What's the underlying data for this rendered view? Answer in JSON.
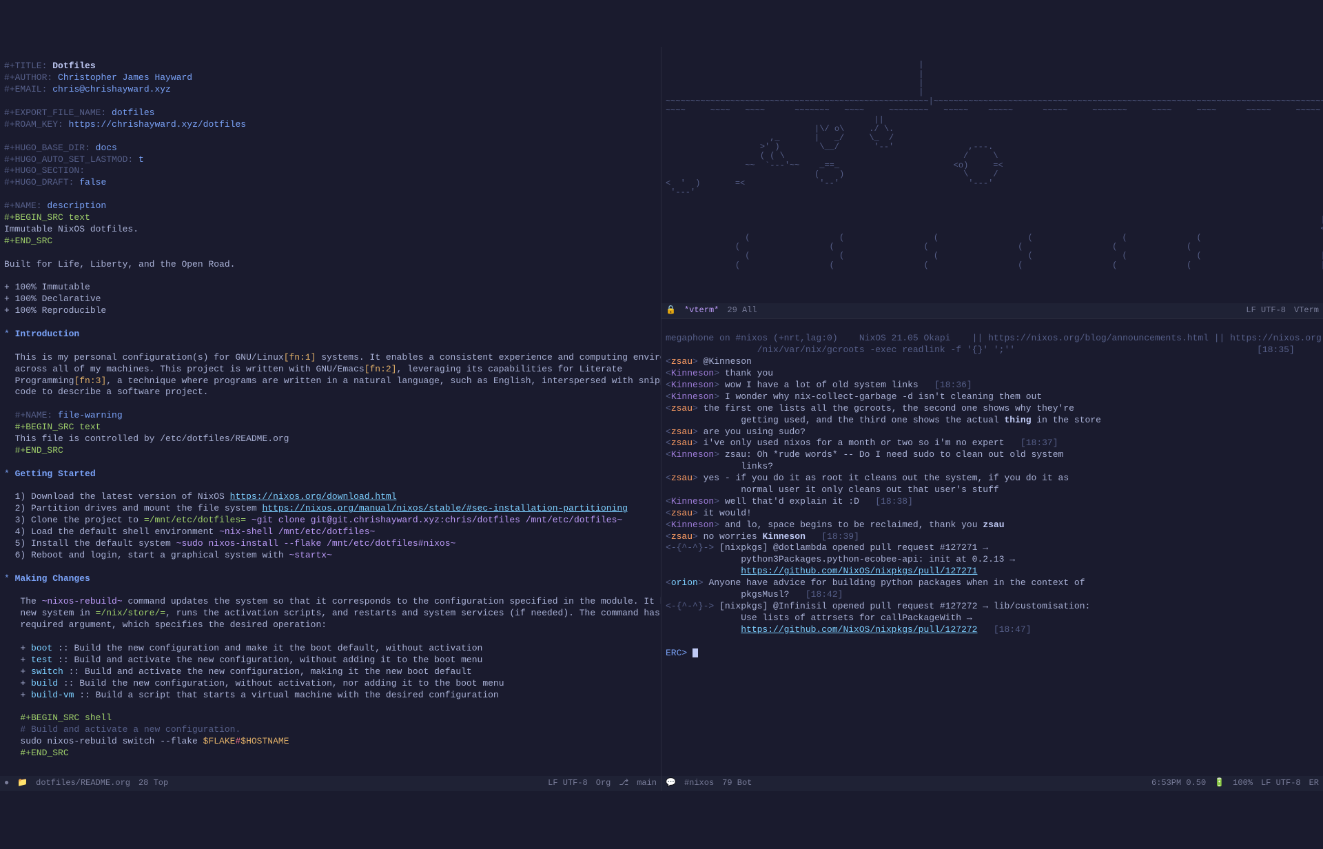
{
  "org": {
    "k_title": "#+TITLE:",
    "title": "Dotfiles",
    "k_author": "#+AUTHOR:",
    "author": "Christopher James Hayward",
    "k_email": "#+EMAIL:",
    "email": "chris@chrishayward.xyz",
    "k_export": "#+EXPORT_FILE_NAME:",
    "export": "dotfiles",
    "k_roam": "#+ROAM_KEY:",
    "roam": "https://chrishayward.xyz/dotfiles",
    "k_hugodir": "#+HUGO_BASE_DIR:",
    "hugodir": "docs",
    "k_hugolast": "#+HUGO_AUTO_SET_LASTMOD:",
    "hugolast": "t",
    "k_hugosec": "#+HUGO_SECTION:",
    "k_hugodraft": "#+HUGO_DRAFT:",
    "hugodraft": "false",
    "k_name1": "#+NAME:",
    "name1": "description",
    "k_begin_text": "#+BEGIN_SRC text",
    "desc_body": "Immutable NixOS dotfiles.",
    "k_end": "#+END_SRC",
    "tagline": "Built for Life, Liberty, and the Open Road.",
    "bullets": [
      "+ 100% Immutable",
      "+ 100% Declarative",
      "+ 100% Reproducible"
    ],
    "h_intro": "Introduction",
    "intro_1a": "This is my personal configuration(s) for GNU/Linux",
    "fn1": "[fn:1]",
    "intro_1b": " systems. It enables a consistent experience and computing environment",
    "intro_2a": "across all of my machines. This project is written with GNU/Emacs",
    "fn2": "[fn:2]",
    "intro_2b": ", leveraging its capabilities for Literate",
    "intro_3a": "Programming",
    "fn3": "[fn:3]",
    "intro_3b": ", a technique where programs are written in a natural language, such as English, interspersed with snippets of",
    "intro_4": "code to describe a software project.",
    "k_name2": "#+NAME:",
    "name2": "file-warning",
    "fw_body": "This file is controlled by /etc/dotfiles/README.org",
    "h_getting": "Getting Started",
    "gs1a": "1) Download the latest version of NixOS ",
    "gs1link": "https://nixos.org/download.html",
    "gs2a": "2) Partition drives and mount the file system ",
    "gs2link": "https://nixos.org/manual/nixos/stable/#sec-installation-partitioning",
    "gs3a": "3) Clone the project to ",
    "gs3c1": "=/mnt/etc/dotfiles=",
    "gs3c2": " ~git clone git@git.chrishayward.xyz:chris/dotfiles /mnt/etc/dotfiles~",
    "gs4a": "4) Load the default shell environment ",
    "gs4c": "~nix-shell /mnt/etc/dotfiles~",
    "gs5a": "5) Install the default system ",
    "gs5c": "~sudo nixos-install --flake /mnt/etc/dotfiles#nixos~",
    "gs6a": "6) Reboot and login, start a graphical system with ",
    "gs6c": "~startx~",
    "h_making": "Making Changes",
    "mc1a": "The ",
    "mc1c": "~nixos-rebuild~",
    "mc1b": " command updates the system so that it corresponds to the configuration specified in the module. It builds the",
    "mc2a": "new system in ",
    "mc2c": "=/nix/store/=",
    "mc2b": ", runs the activation scripts, and restarts and system services (if needed). The command has one",
    "mc3": "required argument, which specifies the desired operation:",
    "ops": [
      {
        "k": "boot",
        "v": " :: Build the new configuration and make it the boot default, without activation"
      },
      {
        "k": "test",
        "v": " :: Build and activate the new configuration, without adding it to the boot menu"
      },
      {
        "k": "switch",
        "v": " :: Build and activate the new configuration, making it the new boot default"
      },
      {
        "k": "build",
        "v": " :: Build the new configuration, without activation, nor adding it to the boot menu"
      },
      {
        "k": "build-vm",
        "v": " :: Build a script that starts a virtual machine with the desired configuration"
      }
    ],
    "k_begin_shell": "#+BEGIN_SRC shell",
    "sh_comment": "# Build and activate a new configuration.",
    "sh_l": "sudo nixos-rebuild switch --flake ",
    "sh_flake": "$FLAKE",
    "sh_hash": "#",
    "sh_host": "$HOSTNAME",
    "modeline": {
      "file": "dotfiles/README.org",
      "pos": "28 Top",
      "enc": "LF UTF-8",
      "major": "Org",
      "branch": "main"
    }
  },
  "vterm": {
    "ascii": "                                                   |\n                                                   |\n                                                   |\n                                                   |\n~~~~~~~~~~~~~~~~~~~~~~~~~~~~~~~~~~~~~~~~~~~~~~~~~~~~~|~~~~~~~~~~~~~~~~~~~~~~~~~~~~~~~~~~~~~~~~~~~~~~~~~~~~~~~~~~~~~~~~~~~~~~~~~~~~~~~~~~~~~~~~~~~~~~~~~~~~~~~~~~\n~~~~     ~~~~   ~~~~      ~~~~~~~   ~~~~     ~~~~~~~~   ~~~~~    ~~~~~      ~~~~~     ~~~~~~~     ~~~~     ~~~~      ~~~~~     ~~~~~\n                                          ||\n                              |\\/ o\\     ./ \\.             \n                     ,_       |   _/     \\_  /                                                                            \n                   >' )        \\__/       '--'               ,---.\n                   ( ( \\                                    /     \\\n                ~~  `---'~~    _==_                       <o)     =<                                                                    ~~\n                              (    )                        \\     /\n<  '  )       =<               '--'                          '---'                                                                       /\\\n '---'                                                                                                                                  /  \\\n                                                                                                                                      _/    \\_    /\\\n                                                                                                                                     /  \\/ o\\ \\  /  \\\n                                                                                                                                    |   /   \\ | / -- \\\n                                                                                                                                    <o)    <o)/      \\\n                (                  (                  (                  (                  (              (                         \\_/  \\_/        |\n              (                  (                  (                  (                  (              (                                   _,-'|   |\n                (                  (                  (                  (                  (              (                        ||||  ,-'    |   |\n              (                  (                  (                  (                  (              (                          ||||_/       |___|",
    "modeline": {
      "buf": "*vterm*",
      "pos": "29 All",
      "enc": "LF UTF-8",
      "major": "VTerm"
    }
  },
  "irc": {
    "topic1": "megaphone on #nixos (+nrt,lag:0)    NixOS 21.05 Okapi    || https://nixos.org/blog/announcements.html || https://nixos.org || Latest NixO",
    "topic2": "                 /nix/var/nix/gcroots -exec readlink -f '{}' ';''",
    "t1835": "[18:35]",
    "lines": [
      {
        "n": "zsau",
        "c": "z",
        "t": "@Kinneson"
      },
      {
        "n": "Kinneson",
        "c": "k",
        "t": "thank you"
      },
      {
        "n": "Kinneson",
        "c": "k",
        "t": "wow I have a lot of old system links",
        "ts": "[18:36]"
      },
      {
        "n": "Kinneson",
        "c": "k",
        "t": "I wonder why nix-collect-garbage -d isn't cleaning them out"
      },
      {
        "n": "zsau",
        "c": "z",
        "t": "the first one lists all the gcroots, the second one shows why they're"
      },
      {
        "cont": true,
        "t": "getting used, and the third one shows the actual ",
        "b": "thing",
        "t2": " in the store"
      },
      {
        "n": "zsau",
        "c": "z",
        "t": "are you using sudo?"
      },
      {
        "n": "zsau",
        "c": "z",
        "t": "i've only used nixos for a month or two so i'm no expert",
        "ts": "[18:37]"
      },
      {
        "n": "Kinneson",
        "c": "k",
        "t": "zsau: Oh *rude words* -- Do I need sudo to clean out old system"
      },
      {
        "cont": true,
        "t": "links?"
      },
      {
        "n": "zsau",
        "c": "z",
        "t": "yes - if you do it as root it cleans out the system, if you do it as"
      },
      {
        "cont": true,
        "t": "normal user it only cleans out that user's stuff"
      },
      {
        "n": "Kinneson",
        "c": "k",
        "t": "well that'd explain it :D",
        "ts": "[18:38]"
      },
      {
        "n": "zsau",
        "c": "z",
        "t": "it would!"
      },
      {
        "n": "Kinneson",
        "c": "k",
        "t": "and lo, space begins to be reclaimed, thank you ",
        "b": "zsau"
      },
      {
        "n": "zsau",
        "c": "z",
        "t": "no worries ",
        "b": "Kinneson",
        "ts": "[18:39]"
      },
      {
        "n": "-{^-^}-",
        "c": "b",
        "t": "[nixpkgs] @dotlambda opened pull request #127271 →"
      },
      {
        "cont": true,
        "t": "python3Packages.python-ecobee-api: init at 0.2.13 →"
      },
      {
        "cont": true,
        "link": "https://github.com/NixOS/nixpkgs/pull/127271"
      },
      {
        "n": "orion",
        "c": "o",
        "t": "Anyone have advice for building python packages when in the context of"
      },
      {
        "cont": true,
        "t": "pkgsMusl?",
        "ts": "[18:42]"
      },
      {
        "n": "-{^-^}-",
        "c": "b",
        "t": "[nixpkgs] @Infinisil opened pull request #127272 → lib/customisation:"
      },
      {
        "cont": true,
        "t": "Use lists of attrsets for callPackageWith →"
      },
      {
        "cont": true,
        "link": "https://github.com/NixOS/nixpkgs/pull/127272",
        "ts": "[18:47]"
      }
    ],
    "prompt": "ERC>",
    "modeline": {
      "buf": "#nixos",
      "pos": "79 Bot",
      "clock": "6:53PM 0.50",
      "batt": "100%",
      "enc": "LF UTF-8",
      "major": "ER"
    }
  }
}
